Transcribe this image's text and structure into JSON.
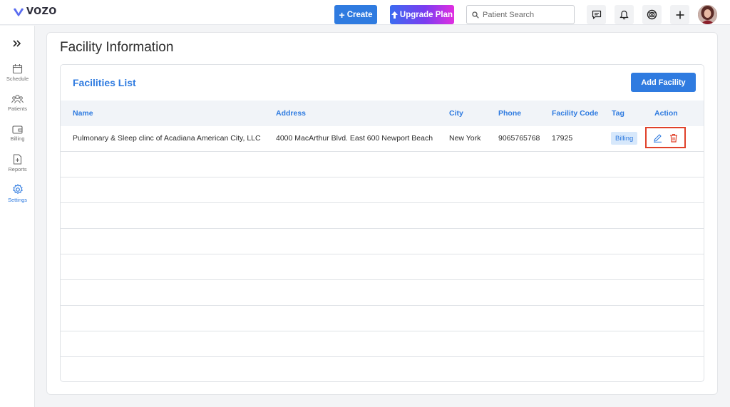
{
  "header": {
    "logo_text": "VOZO",
    "create_label": "Create",
    "upgrade_label": "Upgrade Plan",
    "search_placeholder": "Patient Search"
  },
  "sidebar": {
    "items": [
      {
        "label": "Schedule",
        "icon": "calendar-icon"
      },
      {
        "label": "Patients",
        "icon": "patients-icon"
      },
      {
        "label": "Billing",
        "icon": "wallet-icon"
      },
      {
        "label": "Reports",
        "icon": "report-icon"
      },
      {
        "label": "Settings",
        "icon": "gear-icon",
        "active": true
      }
    ]
  },
  "page": {
    "title": "Facility Information",
    "list_title": "Facilities List",
    "add_button": "Add Facility"
  },
  "table": {
    "columns": [
      "Name",
      "Address",
      "City",
      "Phone",
      "Facility Code",
      "Tag",
      "Action"
    ],
    "rows": [
      {
        "name": "Pulmonary & Sleep clinc of Acadiana American City, LLC",
        "address": "4000 MacArthur Blvd. East 600 Newport Beach",
        "city": "New York",
        "phone": "9065765768",
        "code": "17925",
        "tag": "Billing"
      }
    ]
  },
  "colors": {
    "accent": "#2f7be0",
    "highlight": "#e0412a",
    "delete": "#e0412a"
  }
}
